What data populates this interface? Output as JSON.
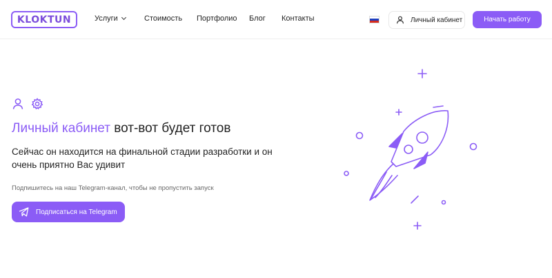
{
  "header": {
    "logo": "KLOKTUN",
    "nav": [
      {
        "label": "Услуги",
        "has_dropdown": true
      },
      {
        "label": "Стоимость"
      },
      {
        "label": "Портфолио"
      },
      {
        "label": "Блог"
      },
      {
        "label": "Контакты"
      }
    ],
    "language_flag": "ru-flag-icon",
    "cabinet_label": "Личный кабинет",
    "start_label": "Начать работу"
  },
  "main": {
    "title_accent": "Личный кабинет",
    "title_rest": " вот-вот будет готов",
    "description": "Сейчас он находится на финальной стадии разработки и он очень приятно Вас удивит",
    "hint": "Подпишитесь на наш Telegram-канал, чтобы не пропустить запуск",
    "telegram_button": "Подписаться на Telegram"
  },
  "colors": {
    "accent": "#8b5cf6",
    "text": "#222222",
    "muted": "#666666"
  }
}
